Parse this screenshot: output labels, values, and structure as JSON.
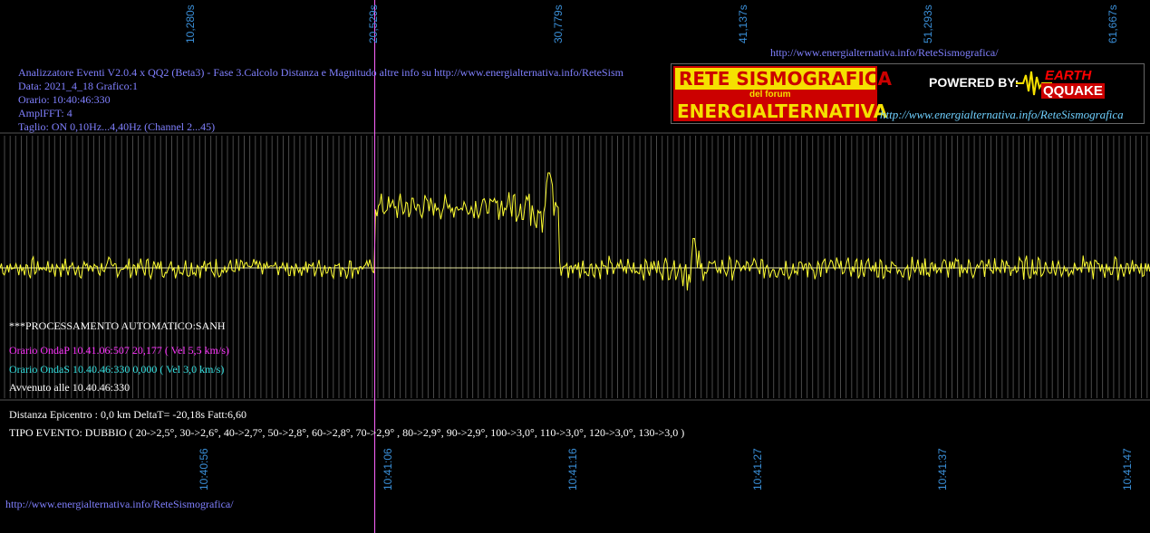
{
  "header": {
    "title_line": "Analizzatore Eventi V2.0.4 x QQ2 (Beta3) - Fase 3.Calcolo Distanza e Magnitudo altre info su http://www.energialternativa.info/ReteSism",
    "data_line": "Data: 2021_4_18 Grafico:1",
    "orario_line": "Orario: 10:40:46:330",
    "amplfft_line": "AmplFFT: 4",
    "taglio_line": "Taglio: ON 0,10Hz...4,40Hz       (Channel 2...45)",
    "top_url": "http://www.energialternativa.info/ReteSismografica/"
  },
  "logo": {
    "line1": "RETE SISMOGRAFICA",
    "line2": "del forum",
    "line3": "ENERGIALTERNATIVA",
    "powered": "POWERED BY:",
    "earth": "EARTH",
    "quake": "QQUAKE",
    "url": "http://www.energialternativa.info/ReteSismografica"
  },
  "notes": {
    "processing": "***PROCESSAMENTO AUTOMATICO:SANH",
    "onda_p": "Orario OndaP 10.41.06:507  20,177 ( Vel 5,5 km/s)",
    "onda_s": "Orario OndaS 10.40.46:330  0,000 ( Vel 3,0 km/s)",
    "avvenuto": "Avvenuto alle 10.40.46:330",
    "distanza": "Distanza Epicentro : 0,0 km DeltaT= -20,18s  Fatt:6,60",
    "tipo_evento": "TIPO EVENTO: DUBBIO ( 20->2,5°, 30->2,6°, 40->2,7°, 50->2,8°, 60->2,8°, 70->2,9° , 80->2,9°, 90->2,9°, 100->3,0°, 110->3,0°, 120->3,0°, 130->3,0 )"
  },
  "footer_url": "http://www.energialternativa.info/ReteSismografica/",
  "colors": {
    "background": "#000000",
    "trace": "#ffff33",
    "grid": "#4a4a4a",
    "marker": "#ff66ff",
    "axis_label": "#3a8fd8",
    "info_text": "#8080ff",
    "onda_p": "#ff33ff",
    "onda_s": "#33e0e0",
    "white_text": "#ffffff"
  },
  "chart_data": {
    "type": "line",
    "x_unit": "s",
    "top_ticks": [
      "10,280s",
      "20,529s",
      "30,779s",
      "41,137s",
      "51,293s",
      "61,667s"
    ],
    "bottom_ticks": [
      "10:40:56",
      "10:41:06",
      "10:41:16",
      "10:41:27",
      "10:41:37",
      "10:41:47"
    ],
    "xlim": [
      0,
      63
    ],
    "ylim": [
      -1.2,
      2.1
    ],
    "p_wave_marker_s": 20.53,
    "segments": [
      {
        "x_start": 0,
        "x_end": 20.4,
        "level": 0.0,
        "amplitude": 0.18
      },
      {
        "x_start": 20.5,
        "x_end": 27.8,
        "level": 1.35,
        "amplitude": 0.22
      },
      {
        "x_start": 27.8,
        "x_end": 30.6,
        "level": 1.4,
        "amplitude": 0.5
      },
      {
        "x_start": 30.7,
        "x_end": 63,
        "level": 0.0,
        "amplitude": 0.2
      }
    ],
    "series": [
      {
        "values_sampled": [
          0.05,
          0.1,
          -0.08,
          0.12,
          -0.15,
          0.2,
          -0.1,
          0.05,
          0.15,
          -0.2,
          0.1,
          0.05,
          -0.12,
          0.08,
          1.35,
          1.3,
          1.45,
          1.25,
          1.4,
          1.35,
          1.5,
          1.45,
          1.6,
          1.55,
          1.7,
          2.1,
          -0.05,
          0.15,
          -0.1,
          0.2,
          -0.2,
          0.05,
          0.4,
          -0.3,
          0.1,
          0.05,
          -0.08,
          0.1,
          0.0,
          0.05,
          -0.05,
          0.08,
          -0.05,
          0.05,
          0.0
        ]
      }
    ]
  }
}
